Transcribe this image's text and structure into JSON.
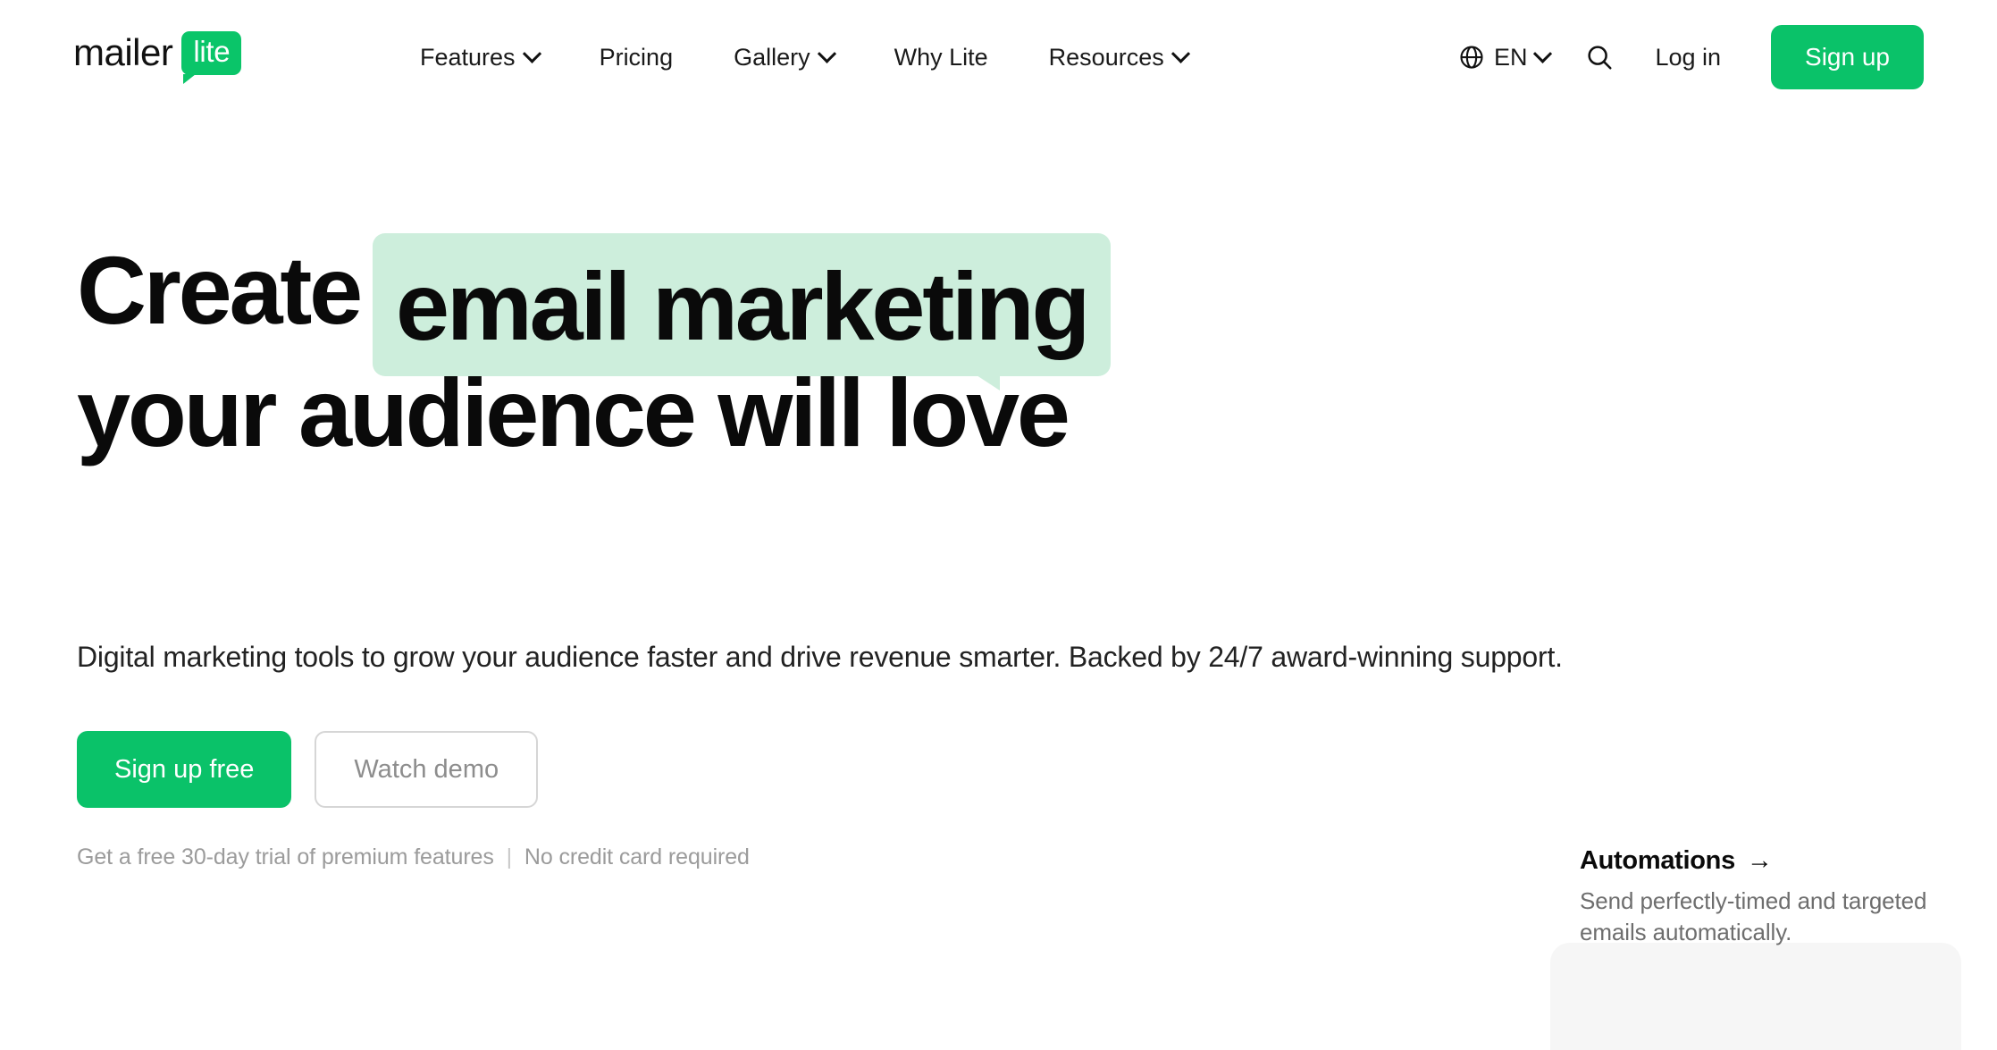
{
  "brand": {
    "word": "mailer",
    "badge": "lite"
  },
  "nav": {
    "items": [
      {
        "label": "Features",
        "has_dropdown": true
      },
      {
        "label": "Pricing",
        "has_dropdown": false
      },
      {
        "label": "Gallery",
        "has_dropdown": true
      },
      {
        "label": "Why Lite",
        "has_dropdown": false
      },
      {
        "label": "Resources",
        "has_dropdown": true
      }
    ],
    "language": {
      "code": "EN",
      "icon": "globe-icon"
    },
    "search_icon": "search-icon",
    "login_label": "Log in",
    "signup_label": "Sign up"
  },
  "hero": {
    "headline_part1": "Create",
    "headline_highlight": "email marketing",
    "headline_line2": "your audience will love",
    "subhead": "Digital marketing tools to grow your audience faster and drive revenue smarter. Backed by 24/7 award-winning support.",
    "cta_primary": "Sign up free",
    "cta_secondary": "Watch demo",
    "trial_left": "Get a free 30-day trial of premium features",
    "trial_sep": "|",
    "trial_right": "No credit card required"
  },
  "feature_card": {
    "title": "Automations",
    "arrow": "→",
    "description": "Send perfectly-timed and targeted emails automatically."
  },
  "colors": {
    "brand_green": "#0ac269",
    "highlight_mint": "#cdeedc",
    "text_dark": "#0a0a0a",
    "text_muted": "#6e6e6e",
    "trial_text": "#9b9b9b",
    "panel_gray": "#f6f6f6"
  }
}
